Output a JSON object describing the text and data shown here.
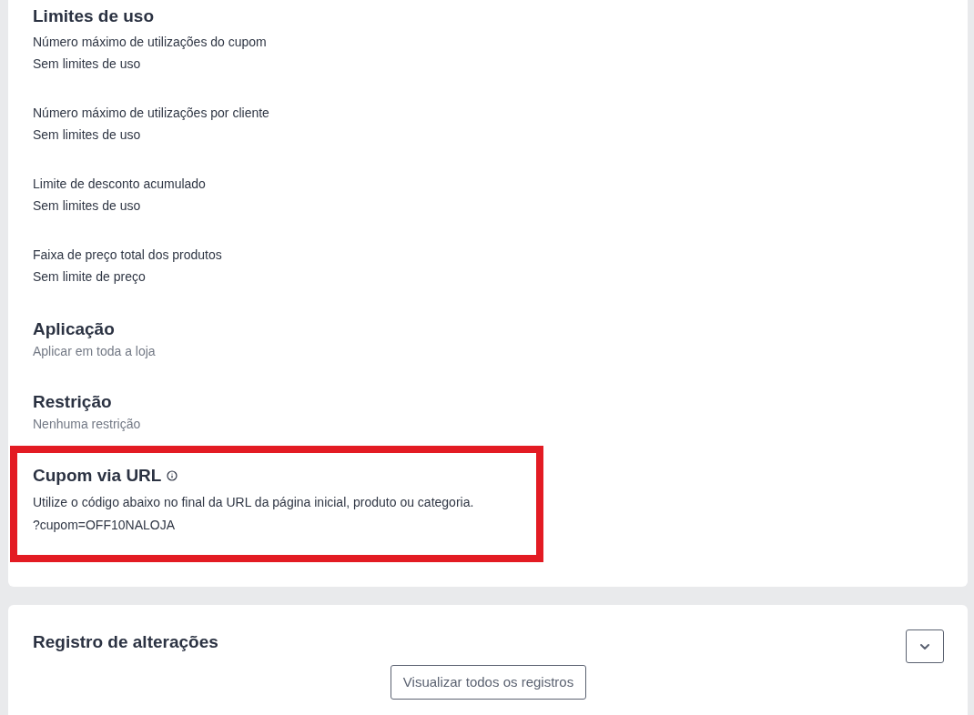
{
  "sections": [
    {
      "kind": "limits",
      "title": "Limites de uso",
      "highlighted": false,
      "items": [
        {
          "label": "Número máximo de utilizações do cupom",
          "value": "Sem limites de uso"
        },
        {
          "label": "Número máximo de utilizações por cliente",
          "value": "Sem limites de uso"
        },
        {
          "label": "Limite de desconto acumulado",
          "value": "Sem limites de uso"
        },
        {
          "label": "Faixa de preço total dos produtos",
          "value": "Sem limite de preço"
        }
      ]
    },
    {
      "kind": "summary",
      "title": "Aplicação",
      "value": "Aplicar em toda a loja",
      "highlighted": false
    },
    {
      "kind": "summary",
      "title": "Restrição",
      "value": "Nenhuma restrição",
      "highlighted": false
    },
    {
      "kind": "url_coupon",
      "title": "Cupom via URL",
      "description": "Utilize o código abaixo no final da URL da página inicial, produto ou categoria.",
      "code": "?cupom=OFF10NALOJA",
      "highlighted": true
    }
  ],
  "change_log": {
    "title": "Registro de alterações",
    "expanded": false,
    "view_all_button": "Visualizar todos os registros"
  }
}
